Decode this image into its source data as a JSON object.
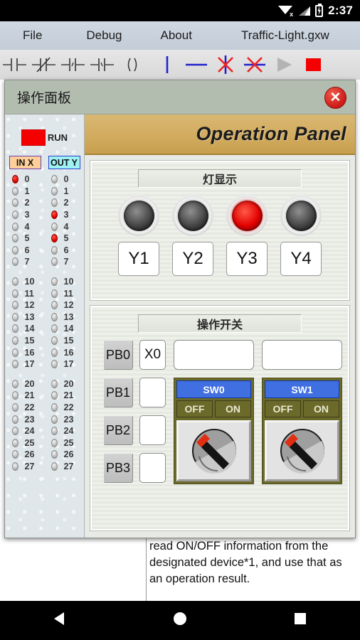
{
  "statusbar": {
    "time": "2:37",
    "icons": [
      "wifi-off-icon",
      "signal-icon",
      "battery-charging-icon"
    ]
  },
  "menubar": {
    "file": "File",
    "debug": "Debug",
    "about": "About",
    "document_title": "Traffic-Light.gxw"
  },
  "toolbar": {
    "items": [
      {
        "name": "contact-no-icon",
        "label": "Normally Open Contact"
      },
      {
        "name": "contact-nc-icon",
        "label": "Normally Closed Contact"
      },
      {
        "name": "contact-rising-edge-icon",
        "label": "Rising Edge Pulse"
      },
      {
        "name": "contact-falling-edge-icon",
        "label": "Falling Edge Pulse"
      },
      {
        "name": "output-coil-icon",
        "label": "Output Coil"
      },
      {
        "name": "vertical-line-icon",
        "label": "Vertical Line"
      },
      {
        "name": "horizontal-line-icon",
        "label": "Horizontal Line"
      },
      {
        "name": "delete-vertical-line-icon",
        "label": "Delete Vertical Line"
      },
      {
        "name": "delete-horizontal-line-icon",
        "label": "Delete Horizontal Line"
      },
      {
        "name": "run-icon",
        "label": "Run"
      },
      {
        "name": "stop-icon",
        "label": "Stop"
      }
    ],
    "accent_blue": "#2222cc",
    "accent_red": "#ee2222",
    "stop_color": "#f40000"
  },
  "document_text": {
    "line1": "read ON/OFF information from the",
    "line2": "designated device*1, and use that as",
    "line3": "an operation result."
  },
  "dialog": {
    "title": "操作面板",
    "close_label": "✕",
    "banner_title": "Operation Panel"
  },
  "io_pane": {
    "run_label": "RUN",
    "run_color": "#f40000",
    "header_in": "IN X",
    "header_out": "OUT Y",
    "in_groups": [
      {
        "leds": [
          {
            "num": "0",
            "on": true
          },
          {
            "num": "1",
            "on": false
          },
          {
            "num": "2",
            "on": false
          },
          {
            "num": "3",
            "on": false
          },
          {
            "num": "4",
            "on": false
          },
          {
            "num": "5",
            "on": false
          },
          {
            "num": "6",
            "on": false
          },
          {
            "num": "7",
            "on": false
          }
        ]
      },
      {
        "leds": [
          {
            "num": "10",
            "on": false
          },
          {
            "num": "11",
            "on": false
          },
          {
            "num": "12",
            "on": false
          },
          {
            "num": "13",
            "on": false
          },
          {
            "num": "14",
            "on": false
          },
          {
            "num": "15",
            "on": false
          },
          {
            "num": "16",
            "on": false
          },
          {
            "num": "17",
            "on": false
          }
        ]
      },
      {
        "leds": [
          {
            "num": "20",
            "on": false
          },
          {
            "num": "21",
            "on": false
          },
          {
            "num": "22",
            "on": false
          },
          {
            "num": "23",
            "on": false
          },
          {
            "num": "24",
            "on": false
          },
          {
            "num": "25",
            "on": false
          },
          {
            "num": "26",
            "on": false
          },
          {
            "num": "27",
            "on": false
          }
        ]
      }
    ],
    "out_groups": [
      {
        "leds": [
          {
            "num": "0",
            "on": false
          },
          {
            "num": "1",
            "on": false
          },
          {
            "num": "2",
            "on": false
          },
          {
            "num": "3",
            "on": true
          },
          {
            "num": "4",
            "on": false
          },
          {
            "num": "5",
            "on": true
          },
          {
            "num": "6",
            "on": false
          },
          {
            "num": "7",
            "on": false
          }
        ]
      },
      {
        "leds": [
          {
            "num": "10",
            "on": false
          },
          {
            "num": "11",
            "on": false
          },
          {
            "num": "12",
            "on": false
          },
          {
            "num": "13",
            "on": false
          },
          {
            "num": "14",
            "on": false
          },
          {
            "num": "15",
            "on": false
          },
          {
            "num": "16",
            "on": false
          },
          {
            "num": "17",
            "on": false
          }
        ]
      },
      {
        "leds": [
          {
            "num": "20",
            "on": false
          },
          {
            "num": "21",
            "on": false
          },
          {
            "num": "22",
            "on": false
          },
          {
            "num": "23",
            "on": false
          },
          {
            "num": "24",
            "on": false
          },
          {
            "num": "25",
            "on": false
          },
          {
            "num": "26",
            "on": false
          },
          {
            "num": "27",
            "on": false
          }
        ]
      }
    ]
  },
  "lights_group": {
    "legend": "灯显示",
    "lamps": [
      {
        "label": "Y1",
        "on": false
      },
      {
        "label": "Y2",
        "on": false
      },
      {
        "label": "Y3",
        "on": true
      },
      {
        "label": "Y4",
        "on": false
      }
    ],
    "on_color": "#e20000"
  },
  "switch_group": {
    "legend": "操作开关",
    "pushbuttons": [
      {
        "label": "PB0",
        "value": "X0"
      },
      {
        "label": "PB1",
        "value": ""
      },
      {
        "label": "PB2",
        "value": ""
      },
      {
        "label": "PB3",
        "value": ""
      }
    ],
    "switches": [
      {
        "top_field": "",
        "name": "SW0",
        "off_label": "OFF",
        "on_label": "ON",
        "position": "off"
      },
      {
        "top_field": "",
        "name": "SW1",
        "off_label": "OFF",
        "on_label": "ON",
        "position": "off"
      }
    ],
    "name_color": "#3f6fe0",
    "frame_color": "#6b6a2b"
  },
  "navbar": {
    "back": "back-icon",
    "home": "home-icon",
    "recents": "recents-icon"
  }
}
